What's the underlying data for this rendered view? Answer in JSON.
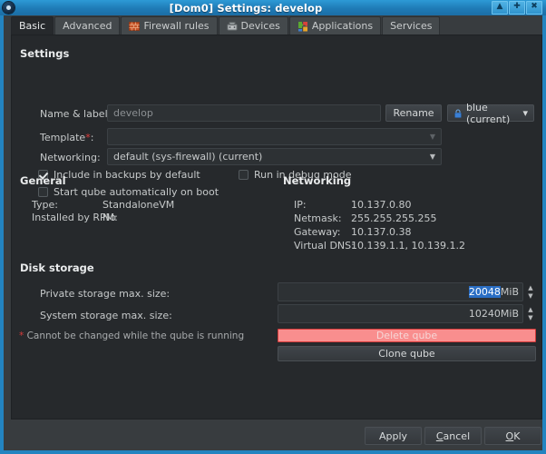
{
  "window": {
    "title": "[Dom0] Settings: develop",
    "icon": "settings-gear-icon",
    "controls": [
      {
        "name": "minimize",
        "glyph": "▲"
      },
      {
        "name": "maximize",
        "glyph": "✚"
      },
      {
        "name": "close",
        "glyph": "✖"
      }
    ]
  },
  "tabs": [
    {
      "label": "Basic",
      "icon": null,
      "active": true
    },
    {
      "label": "Advanced",
      "icon": null,
      "active": false
    },
    {
      "label": "Firewall rules",
      "icon": "firewall-icon",
      "active": false
    },
    {
      "label": "Devices",
      "icon": "devices-icon",
      "active": false
    },
    {
      "label": "Applications",
      "icon": "applications-puzzle-icon",
      "active": false
    },
    {
      "label": "Services",
      "icon": null,
      "active": false
    }
  ],
  "settings": {
    "heading": "Settings",
    "name_label": "Name & label",
    "name_required_mark": "*",
    "name_colon": ":",
    "name_value": "develop",
    "rename_button": "Rename",
    "label_button": "blue (current)",
    "label_color": "#3a7fd5",
    "label_arrow": "▾",
    "template_label": "Template",
    "template_required_mark": "*",
    "template_colon": ":",
    "template_value": "",
    "networking_label": "Networking:",
    "networking_value": "default (sys-firewall) (current)",
    "checkboxes": [
      {
        "label": "Include in backups by default",
        "checked": true
      },
      {
        "label": "Run in debug mode",
        "checked": false
      },
      {
        "label": "Start qube automatically on boot",
        "checked": false
      }
    ]
  },
  "general": {
    "heading": "General",
    "rows": [
      {
        "key": "Type:",
        "value": "StandaloneVM"
      },
      {
        "key": "Installed by RPM:",
        "value": "No"
      }
    ]
  },
  "networking": {
    "heading": "Networking",
    "rows": [
      {
        "key": "IP:",
        "value": "10.137.0.80"
      },
      {
        "key": "Netmask:",
        "value": "255.255.255.255"
      },
      {
        "key": "Gateway:",
        "value": "10.137.0.38"
      },
      {
        "key": "Virtual DNS:",
        "value": "10.139.1.1, 10.139.1.2"
      }
    ]
  },
  "disk": {
    "heading": "Disk storage",
    "private_label": "Private storage max. size:",
    "private_value": "20048",
    "private_unit": "MiB",
    "private_selected": true,
    "system_label": "System storage max. size:",
    "system_value": "10240",
    "system_unit": "MiB",
    "note_star": "*",
    "note_text": " Cannot be changed while the qube is running",
    "delete_button": "Delete qube",
    "delete_color": "#f98e8e",
    "clone_button": "Clone qube"
  },
  "footer": {
    "apply": "Apply",
    "cancel_pre": "",
    "cancel_accel": "C",
    "cancel_post": "ancel",
    "ok_accel": "O",
    "ok_post": "K"
  }
}
